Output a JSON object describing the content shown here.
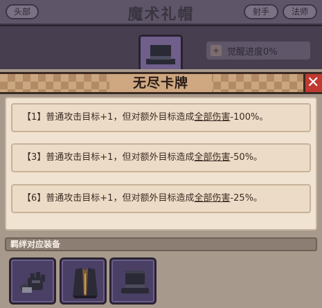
{
  "background": {
    "title": "魔术礼帽",
    "tab_head": "头部",
    "tab_archer": "射手",
    "tab_mage": "法师",
    "awaken_progress": "觉醒进度0%",
    "awaken_plus": "+"
  },
  "modal": {
    "title": "无尽卡牌",
    "close_label": "✕",
    "effects": [
      {
        "level": "【1】",
        "prefix": "普通攻击目标+1，但对额外目标造成",
        "keyword": "全部伤害",
        "value": "-100%。"
      },
      {
        "level": "【3】",
        "prefix": "普通攻击目标+1，但对额外目标造成",
        "keyword": "全部伤害",
        "value": "-50%。"
      },
      {
        "level": "【6】",
        "prefix": "普通攻击目标+1，但对额外目标造成",
        "keyword": "全部伤害",
        "value": "-25%。"
      }
    ],
    "bond_label": "羁绊对应装备",
    "equipment": [
      {
        "icon": "gauntlet-icon"
      },
      {
        "icon": "coat-icon"
      },
      {
        "icon": "top-hat-icon"
      }
    ]
  },
  "colors": {
    "accent_close": "#c13a2f",
    "panel_bg": "#f1e3d1",
    "slot_bg": "#4a3f64"
  }
}
